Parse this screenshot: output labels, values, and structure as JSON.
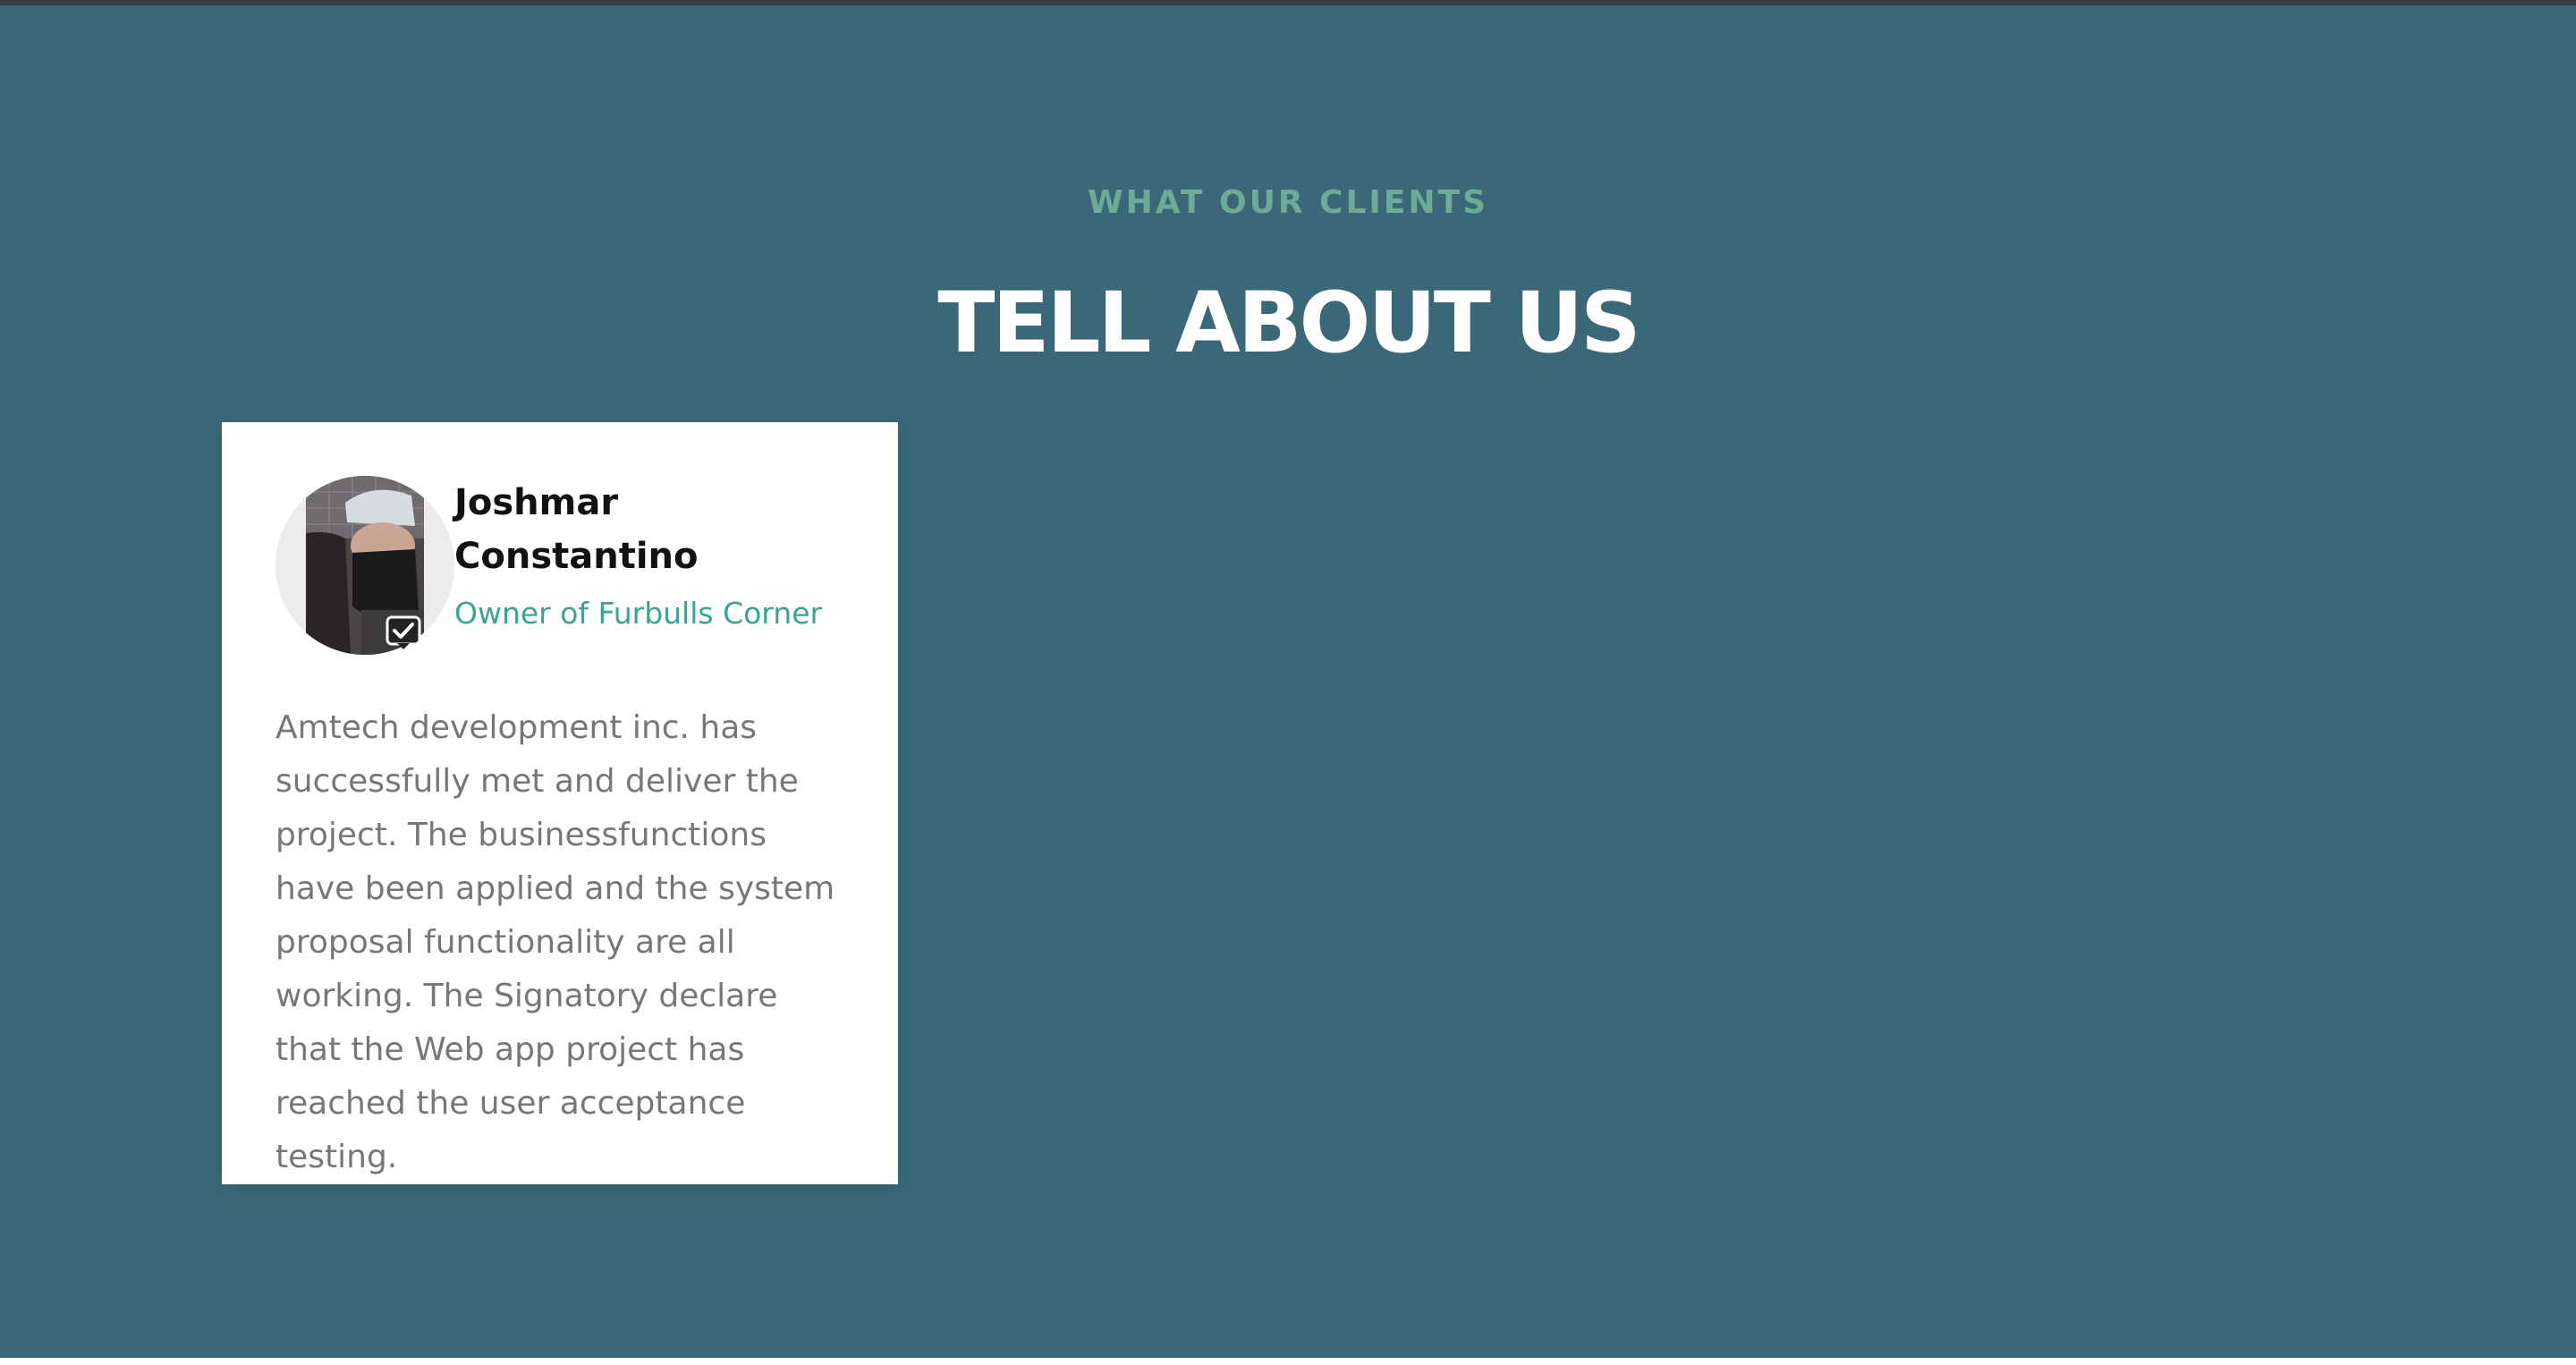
{
  "section": {
    "eyebrow": "WHAT OUR CLIENTS",
    "headline": "TELL ABOUT US"
  },
  "testimonial": {
    "name": "Joshmar Constantino",
    "role": "Owner of Furbulls Corner",
    "quote": "Amtech development inc. has successfully met and deliver the project. The businessfunctions have been applied and the system proposal functionality are all working. The Signatory declare that the Web app project has reached the user acceptance testing.",
    "avatar_icon": "person-avatar-icon",
    "badge_icon": "verified-check-icon"
  },
  "colors": {
    "background": "#3b6878",
    "eyebrow": "#6cab98",
    "headline": "#ffffff",
    "card": "#ffffff",
    "role": "#3aa394",
    "quote": "#777777",
    "name": "#111111"
  }
}
